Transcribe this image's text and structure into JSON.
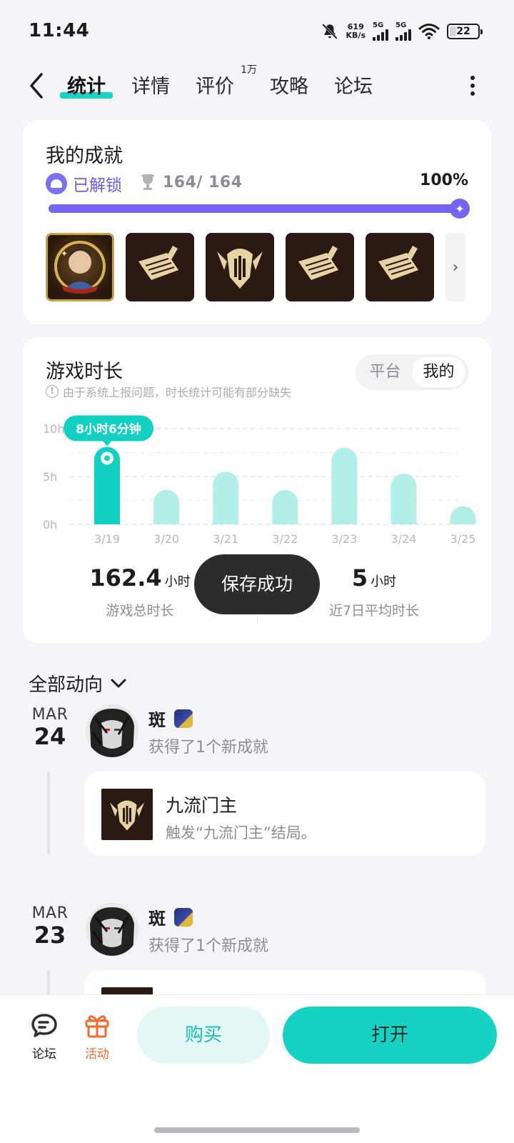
{
  "status_bar": {
    "time": "11:44",
    "speed_value": "619",
    "speed_unit": "KB/s",
    "network1": "5G",
    "network2": "5G",
    "battery": "22"
  },
  "nav": {
    "tabs": [
      {
        "label": "统计",
        "active": true
      },
      {
        "label": "详情"
      },
      {
        "label": "评价",
        "badge": "1万"
      },
      {
        "label": "攻略"
      },
      {
        "label": "论坛"
      }
    ]
  },
  "achievements": {
    "title": "我的成就",
    "unlocked_label": "已解锁",
    "count": "164/ 164",
    "percent": "100%",
    "progress": 1.0
  },
  "playtime": {
    "title": "游戏时长",
    "note": "由于系统上报问题，时长统计可能有部分缺失",
    "toggle": {
      "platform": "平台",
      "mine": "我的"
    },
    "total_value": "162.4",
    "total_unit": "小时",
    "total_caption": "游戏总时长",
    "avg_value": "5",
    "avg_unit": "小时",
    "avg_caption": "近7日平均时长",
    "tooltip": "8小时6分钟"
  },
  "chart_data": {
    "type": "bar",
    "categories": [
      "3/19",
      "3/20",
      "3/21",
      "3/22",
      "3/23",
      "3/24",
      "3/25"
    ],
    "values": [
      8.1,
      3.6,
      5.5,
      3.6,
      8.0,
      5.3,
      1.1
    ],
    "y_ticks": [
      "10h",
      "5h",
      "0h"
    ],
    "ylim": [
      0,
      10
    ],
    "highlight_index": 0,
    "colors": {
      "highlight": "#12d1c2",
      "normal": "#b2efe9"
    }
  },
  "toast": "保存成功",
  "feed": {
    "header": "全部动向",
    "entries": [
      {
        "month": "MAR",
        "day": "24",
        "user": "斑",
        "action": "获得了1个新成就",
        "achievement_title": "九流门主",
        "achievement_desc": "触发“九流门主”结局。"
      },
      {
        "month": "MAR",
        "day": "23",
        "user": "斑",
        "action": "获得了1个新成就"
      }
    ]
  },
  "bottom_bar": {
    "forum": "论坛",
    "activity": "活动",
    "buy": "购买",
    "open": "打开",
    "accent": "#16d2c2",
    "activity_color": "#f26a2f"
  }
}
